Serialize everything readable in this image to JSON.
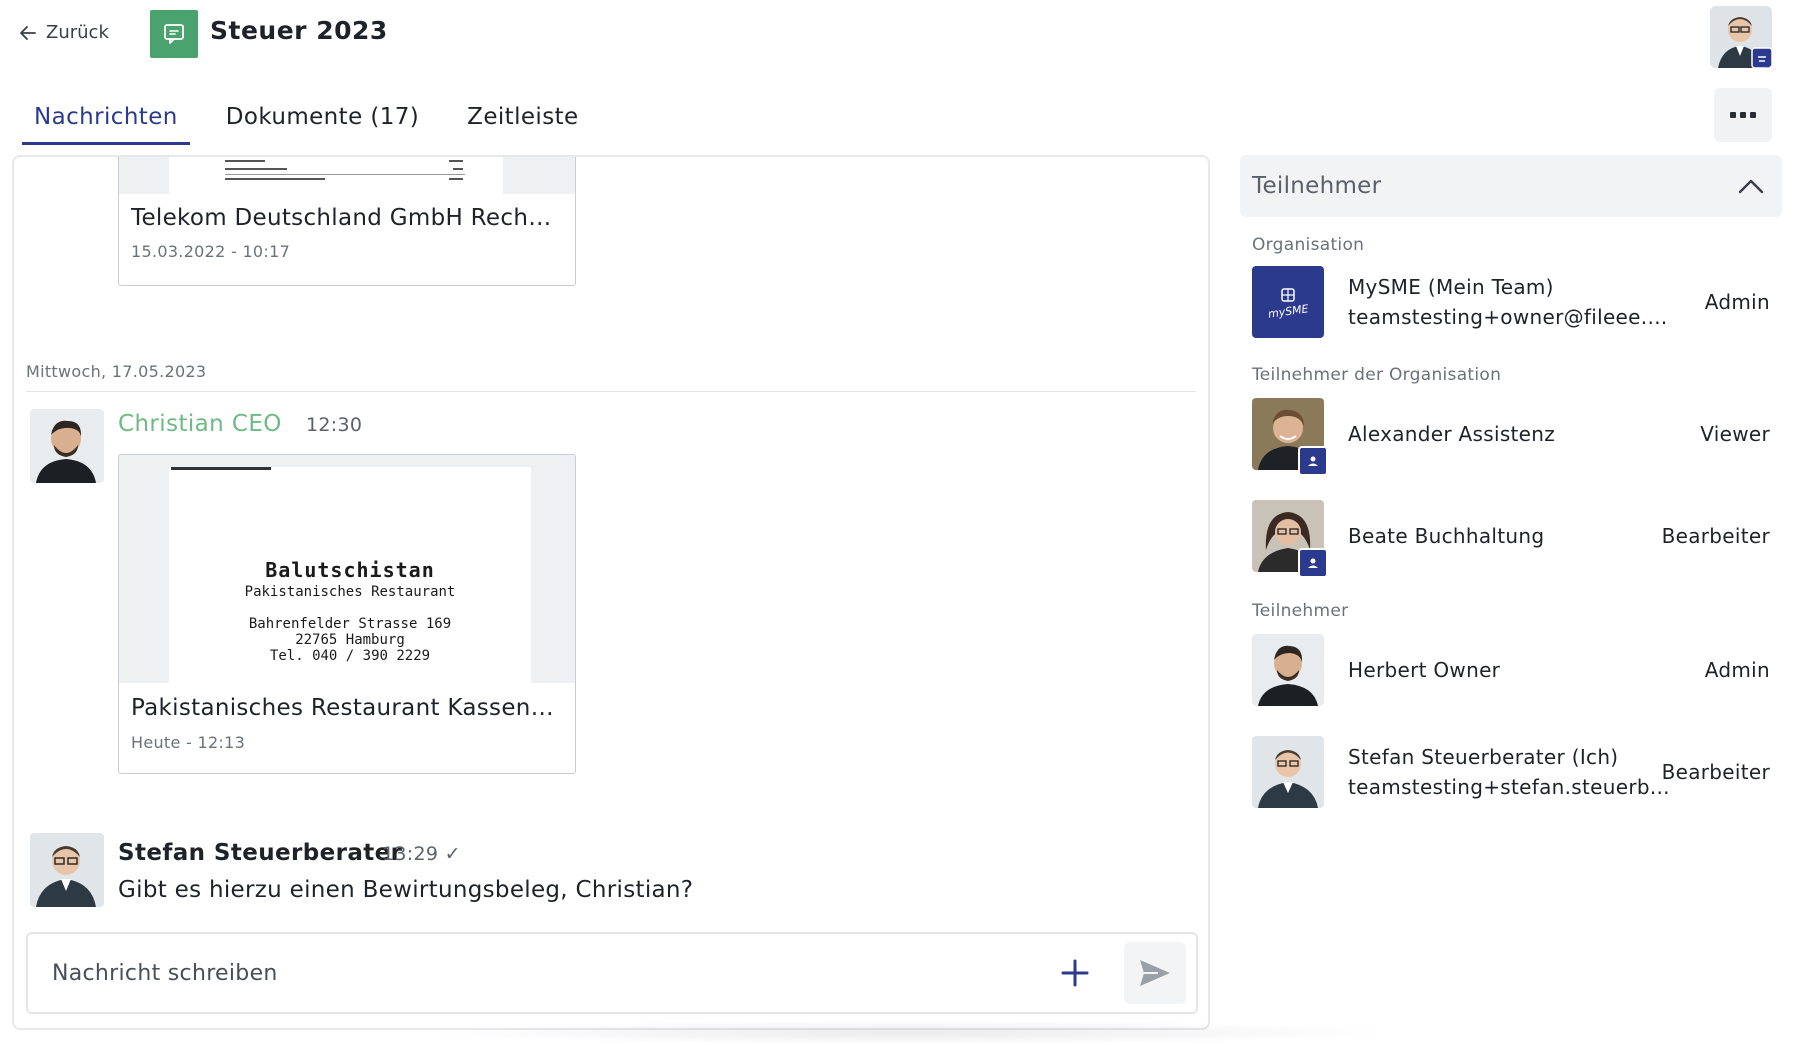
{
  "header": {
    "back_label": "Zurück",
    "title": "Steuer 2023"
  },
  "tabs": [
    {
      "label": "Nachrichten",
      "active": true
    },
    {
      "label": "Dokumente (17)",
      "active": false
    },
    {
      "label": "Zeitleiste",
      "active": false
    }
  ],
  "chat": {
    "doc1": {
      "title": "Telekom Deutschland GmbH Rechn...",
      "date": "15.03.2022 - 10:17"
    },
    "day_divider": "Mittwoch, 17.05.2023",
    "msg1": {
      "author": "Christian CEO",
      "time": "12:30",
      "doc": {
        "title": "Pakistanisches Restaurant Kassenz...",
        "date": "Heute - 12:13",
        "receipt_lines": [
          "Balutschistan",
          "Pakistanisches Restaurant",
          "Bahrenfelder Strasse 169",
          "22765 Hamburg",
          "Tel. 040 / 390 2229"
        ]
      }
    },
    "msg2": {
      "author": "Stefan Steuerberater",
      "time": "13:29 ✓",
      "text": "Gibt es hierzu einen Bewirtungsbeleg, Christian?"
    },
    "composer": {
      "placeholder": "Nachricht schreiben"
    }
  },
  "participants": {
    "title": "Teilnehmer",
    "sections": {
      "organisation": "Organisation",
      "org_members": "Teilnehmer der Organisation",
      "participants": "Teilnehmer"
    },
    "org": {
      "name": "MySME (Mein Team)",
      "email": "teamstesting+owner@fileee.com",
      "role": "Admin",
      "logo_text": "mySME"
    },
    "org_members": [
      {
        "name": "Alexander Assistenz",
        "role": "Viewer"
      },
      {
        "name": "Beate Buchhaltung",
        "role": "Bearbeiter"
      }
    ],
    "members": [
      {
        "name": "Herbert Owner",
        "role": "Admin"
      },
      {
        "name": "Stefan Steuerberater (Ich)",
        "email": "teamstesting+stefan.steuerb...",
        "role": "Bearbeiter"
      }
    ]
  },
  "colors": {
    "accent": "#2b3a8c",
    "folder_green": "#4aa36f",
    "author_green": "#6dba83"
  }
}
